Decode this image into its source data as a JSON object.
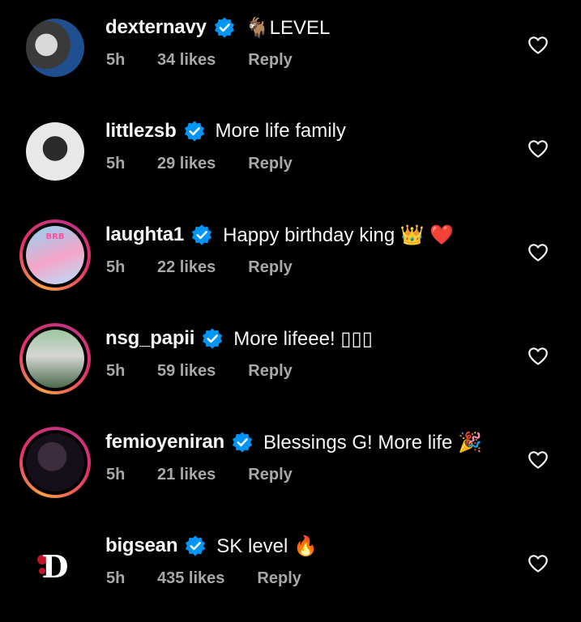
{
  "theme": {
    "background": "#000000",
    "text": "#f5f5f5",
    "muted": "#a8a8a8",
    "verified": "#0095f6",
    "story_ring": [
      "#f9a03f",
      "#e1306c",
      "#c13584"
    ]
  },
  "labels": {
    "reply": "Reply"
  },
  "comments": [
    {
      "username": "dexternavy",
      "text": "🐐LEVEL",
      "time": "5h",
      "likes": "34 likes",
      "avatar_ring": false
    },
    {
      "username": "littlezsb",
      "text": "More life family",
      "time": "5h",
      "likes": "29 likes",
      "avatar_ring": false
    },
    {
      "username": "laughta1",
      "text": "Happy birthday king 👑 ❤️",
      "time": "5h",
      "likes": "22 likes",
      "avatar_ring": true,
      "avatar_badge": "BRB"
    },
    {
      "username": "nsg_papii",
      "text": "More lifeee! ▯▯▯",
      "time": "5h",
      "likes": "59 likes",
      "avatar_ring": true
    },
    {
      "username": "femioyeniran",
      "text": "Blessings G! More life 🎉",
      "time": "5h",
      "likes": "21 likes",
      "avatar_ring": true
    },
    {
      "username": "bigsean",
      "text": "SK level 🔥",
      "time": "5h",
      "likes": "435 likes",
      "avatar_ring": false,
      "avatar_monogram": "D"
    }
  ]
}
